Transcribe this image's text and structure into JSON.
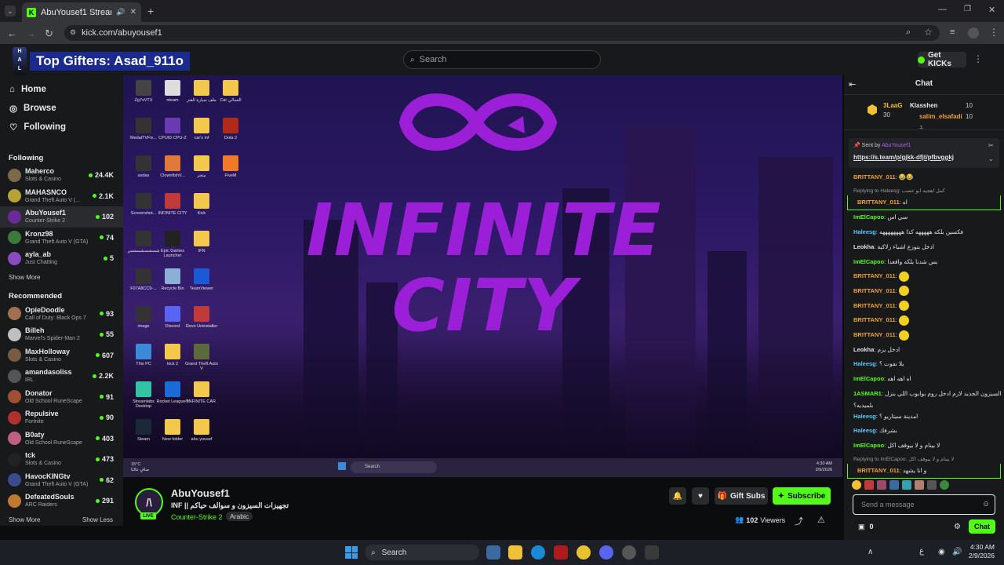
{
  "browser": {
    "tab_title": "AbuYousef1 Stream - Watc",
    "url": "kick.com/abuyousef1"
  },
  "overlay": {
    "top_gifters": "Top Gifters: Asad_911o"
  },
  "header": {
    "search_placeholder": "Search",
    "get_kicks": "Get KICKs"
  },
  "nav": {
    "home": "Home",
    "browse": "Browse",
    "following": "Following"
  },
  "sidebar": {
    "following_title": "Following",
    "following": [
      {
        "name": "Maherco",
        "game": "Slots & Casino",
        "viewers": "24.4K",
        "color": "#7a6a4a"
      },
      {
        "name": "MAHASNCO",
        "game": "Grand Theft Auto V (...",
        "viewers": "2.1K",
        "color": "#b7a23a"
      },
      {
        "name": "AbuYousef1",
        "game": "Counter-Strike 2",
        "viewers": "102",
        "color": "#6b2a9a"
      },
      {
        "name": "Kronz98",
        "game": "Grand Theft Auto V (GTA)",
        "viewers": "74",
        "color": "#3a7a3a"
      },
      {
        "name": "ayla_ab",
        "game": "Just Chatting",
        "viewers": "5",
        "color": "#8a4ac0"
      }
    ],
    "show_more_1": "Show More",
    "recommended_title": "Recommended",
    "recommended": [
      {
        "name": "OpieDoodle",
        "game": "Call of Duty: Black Ops 7",
        "viewers": "93",
        "color": "#a07050"
      },
      {
        "name": "Billeh",
        "game": "Marvel's Spider-Man 2",
        "viewers": "55",
        "color": "#c0c0c0"
      },
      {
        "name": "MaxHolloway",
        "game": "Slots & Casino",
        "viewers": "607",
        "color": "#7a5a40"
      },
      {
        "name": "amandasoliss",
        "game": "IRL",
        "viewers": "2.2K",
        "color": "#555555"
      },
      {
        "name": "Donator",
        "game": "Old School RuneScape",
        "viewers": "91",
        "color": "#a05030"
      },
      {
        "name": "Repulsive",
        "game": "Fortnite",
        "viewers": "90",
        "color": "#b03030"
      },
      {
        "name": "B0aty",
        "game": "Old School RuneScape",
        "viewers": "403",
        "color": "#c06080"
      },
      {
        "name": "tck",
        "game": "Slots & Casino",
        "viewers": "473",
        "color": "#222222"
      },
      {
        "name": "HavocKINGtv",
        "game": "Grand Theft Auto V (GTA)",
        "viewers": "62",
        "color": "#3a4a8a"
      },
      {
        "name": "DefeatedSouls",
        "game": "ARC Raiders",
        "viewers": "291",
        "color": "#c07a30"
      }
    ],
    "show_more_2": "Show More",
    "show_less": "Show Less"
  },
  "video": {
    "title_text": "INFINITE CITY",
    "desktop_icons": [
      {
        "label": "Zg7vVTX",
        "color": "#444"
      },
      {
        "label": "nteam",
        "color": "#ddd"
      },
      {
        "label": "ملف سيارة الفتر",
        "color": "#f2c94c"
      },
      {
        "label": "Car العمالي",
        "color": "#f2c94c"
      },
      {
        "label": "MedalTVFix...",
        "color": "#333"
      },
      {
        "label": "CPUID CPU-Z",
        "color": "#6a3ab0"
      },
      {
        "label": "car's inf",
        "color": "#f2c94c"
      },
      {
        "label": "Dota 2",
        "color": "#b02a1a"
      },
      {
        "label": "asdas",
        "color": "#333"
      },
      {
        "label": "ClownfishV...",
        "color": "#e07a3a"
      },
      {
        "label": "متجر",
        "color": "#f2c94c"
      },
      {
        "label": "FiveM",
        "color": "#f07a2a"
      },
      {
        "label": "Screenshot...",
        "color": "#333"
      },
      {
        "label": "INFINITE CITY",
        "color": "#c03a3a"
      },
      {
        "label": "Kick",
        "color": "#f2c94c"
      },
      {
        "label": "شسشسشسشس",
        "color": "#333"
      },
      {
        "label": "Epic Games Launcher",
        "color": "#222"
      },
      {
        "label": "IFN",
        "color": "#f2c94c"
      },
      {
        "label": "F07A8CC9-...",
        "color": "#333"
      },
      {
        "label": "Recycle Bin",
        "color": "#8ab0d8"
      },
      {
        "label": "TeamViewer",
        "color": "#1a5ad8"
      },
      {
        "label": "image",
        "color": "#333"
      },
      {
        "label": "Discord",
        "color": "#5865f2"
      },
      {
        "label": "Revo Uninstaller",
        "color": "#c03a3a"
      },
      {
        "label": "This PC",
        "color": "#3a8ad8"
      },
      {
        "label": "kick 2",
        "color": "#f2c94c"
      },
      {
        "label": "Grand Theft Auto V",
        "color": "#5a6a3a"
      },
      {
        "label": "Streamlabs Desktop",
        "color": "#31c3a2"
      },
      {
        "label": "Rocket League®",
        "color": "#1a6ad8"
      },
      {
        "label": "INFINITE CAR",
        "color": "#f2c94c"
      },
      {
        "label": "Steam",
        "color": "#1b2838"
      },
      {
        "label": "New folder",
        "color": "#f2c94c"
      },
      {
        "label": "abu yousef",
        "color": "#f2c94c"
      }
    ],
    "weather": "15°C",
    "weather_sub": "صافٍ غالبًا",
    "taskbar_search": "Search",
    "clock_time": "4:30 AM",
    "clock_date": "2/9/2026"
  },
  "stream": {
    "name": "AbuYousef1",
    "title": "INF || تجهيزات السيزون و سوالف حياكم",
    "category": "Counter-Strike 2",
    "tag": "Arabic",
    "live": "LIVE",
    "viewers": "102",
    "viewers_label": "Viewers",
    "gift_subs": "Gift Subs",
    "subscribe": "Subscribe"
  },
  "chat": {
    "title": "Chat",
    "leaderboard": {
      "rank1_name": "3LaaG",
      "rank1_value": "30",
      "rank2_name": "Klasshen",
      "rank2_value": "10",
      "rank3_name": "salim_elsafadi",
      "rank3_value": "10"
    },
    "pinned": {
      "sent_by_label": "Sent by",
      "sent_by_user": "AbuYousef1",
      "link": "https://s.team/p/gjkk-dfjt/pfbvggkj"
    },
    "messages": [
      {
        "user": "BRITTANY_011",
        "text": "😂😂",
        "color": "#f2a134"
      },
      {
        "reply_to": "Replying to Haleesg: كمل اهجيه ابو عصب",
        "user": "BRITTANY_011",
        "text": "اه",
        "color": "#f2a134"
      },
      {
        "user": "ImElCapoo",
        "text": "سي اس",
        "color": "#53fc18"
      },
      {
        "user": "Haleesg",
        "text": "فكسين بلكه هههههه كذا ههههههههه",
        "color": "#5cc8ff"
      },
      {
        "user": "Leokha",
        "text": "ادخل بتوزع اشياء زلاكية",
        "color": "#e4e4e4"
      },
      {
        "user": "ImElCapoo",
        "text": "بس شدنا بلكه واقعدا",
        "color": "#53fc18"
      },
      {
        "user": "BRITTANY_011",
        "text": "",
        "emote": true,
        "color": "#f2a134"
      },
      {
        "user": "BRITTANY_011",
        "text": "",
        "emote": true,
        "color": "#f2a134"
      },
      {
        "user": "BRITTANY_011",
        "text": "",
        "emote": true,
        "color": "#f2a134"
      },
      {
        "user": "BRITTANY_011",
        "text": "",
        "emote": true,
        "color": "#f2a134"
      },
      {
        "user": "BRITTANY_011",
        "text": "",
        "emote": true,
        "color": "#f2a134"
      },
      {
        "user": "Leokha",
        "text": "ادخل يزم",
        "color": "#e4e4e4"
      },
      {
        "user": "Haleesg",
        "text": "يلا نفوت ؟",
        "color": "#5cc8ff"
      },
      {
        "user": "ImElCapoo",
        "text": "اه اهه اهه",
        "color": "#53fc18"
      },
      {
        "user": "1ASMAR1",
        "text": "السيزون الجديد لازم ادخل روم بوابوب اللي بنزل",
        "text2": "بلميديه؟",
        "color": "#53fc18"
      },
      {
        "user": "Haleesg",
        "text": "امدينة سيتاريو ؟",
        "color": "#5cc8ff"
      },
      {
        "user": "Haleesg",
        "text": "بشرفك",
        "color": "#5cc8ff"
      },
      {
        "user": "ImElCapoo",
        "text": "لا بينام و لا بيوقف اكل",
        "color": "#53fc18"
      },
      {
        "reply_to": "Replying to ImElCapoo: لا بينام و لا بيوقف اكل",
        "user": "BRITTANY_011",
        "text": "و انا يشهد",
        "color": "#f2a134"
      }
    ],
    "input_placeholder": "Send a message",
    "kicks_count": "0",
    "chat_button": "Chat"
  },
  "os_taskbar": {
    "search": "Search",
    "time": "4:30 AM",
    "date": "2/9/2026",
    "lang": "ع"
  },
  "colors": {
    "accent": "#53fc18",
    "neon": "#9a1fd6"
  }
}
